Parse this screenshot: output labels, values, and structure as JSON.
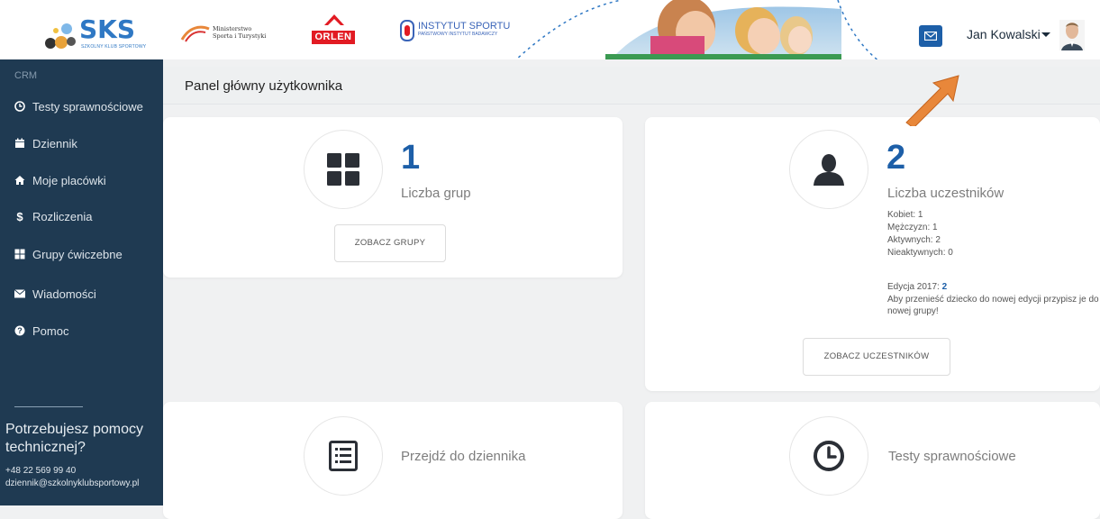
{
  "header": {
    "logo_text": "SKS",
    "logo_subtext": "SZKOLNY KLUB SPORTOWY",
    "sponsor_ministry_line1": "Ministerstwo",
    "sponsor_ministry_line2": "Sporta i Turystyki",
    "sponsor_orlen": "ORLEN",
    "sponsor_institute_line1": "INSTYTUT SPORTU",
    "sponsor_institute_line2": "PAŃSTWOWY INSTYTUT BADAWCZY",
    "user_name": "Jan Kowalski"
  },
  "sidebar": {
    "section_label": "CRM",
    "items": [
      {
        "label": "Testy sprawnościowe",
        "icon": "clock-icon"
      },
      {
        "label": "Dziennik",
        "icon": "calendar-icon"
      },
      {
        "label": "Moje placówki",
        "icon": "home-icon"
      },
      {
        "label": "Rozliczenia",
        "icon": "dollar-icon"
      },
      {
        "label": "Grupy ćwiczebne",
        "icon": "grid-icon"
      },
      {
        "label": "Wiadomości",
        "icon": "envelope-icon"
      },
      {
        "label": "Pomoc",
        "icon": "question-icon"
      }
    ],
    "help_title": "Potrzebujesz pomocy technicznej?",
    "help_phone": "+48 22 569 99 40",
    "help_email": "dziennik@szkolnyklubsportowy.pl"
  },
  "main": {
    "page_title": "Panel główny użytkownika",
    "groups_card": {
      "count": "1",
      "label": "Liczba grup",
      "button": "ZOBACZ GRUPY"
    },
    "participants_card": {
      "count": "2",
      "label": "Liczba uczestników",
      "stats": [
        "Kobiet: 1",
        "Mężczyzn: 1",
        "Aktywnych: 2",
        "Nieaktywnych: 0"
      ],
      "edition_label": "Edycja 2017:",
      "edition_value": "2",
      "note": "Aby przenieść dziecko do nowej edycji przypisz je do nowej grupy!",
      "button": "ZOBACZ UCZESTNIKÓW"
    },
    "journal_card": {
      "label": "Przejdź do dziennika"
    },
    "tests_card": {
      "label": "Testy sprawnościowe"
    }
  },
  "colors": {
    "sidebar_bg": "#1f3a52",
    "accent_blue": "#1d5fa8",
    "arrow_orange": "#e8873a"
  }
}
